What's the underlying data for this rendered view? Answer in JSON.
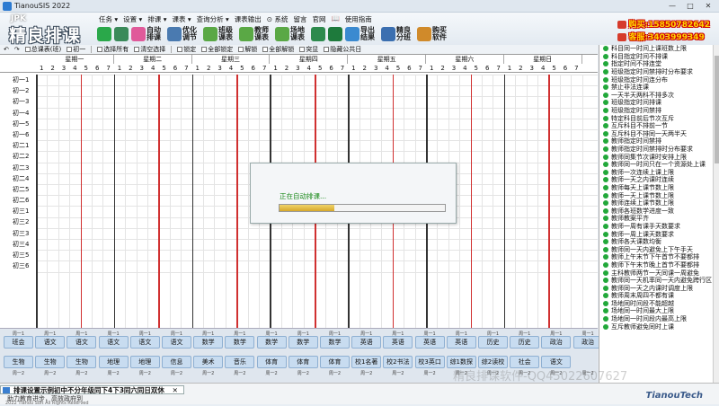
{
  "window": {
    "title": "TianouSIS 2022",
    "controls": [
      "—",
      "□",
      "✕"
    ]
  },
  "brand": {
    "small": "JPK",
    "big": "精良排课"
  },
  "menu": [
    "任务 ▾",
    "设置 ▾",
    "排课 ▾",
    "课表 ▾",
    "查询分析 ▾",
    "课表输出",
    "⊙ 系统",
    "留言",
    "官网",
    "📖",
    "使用指南"
  ],
  "toolbar": [
    {
      "icon": "plus-icon",
      "label": "",
      "color": "#2aa84a"
    },
    {
      "icon": "tools-icon",
      "label": "",
      "color": "#3a8a5a"
    },
    {
      "icon": "auto-schedule-icon",
      "label": "自动排课",
      "color": "#e05a9a"
    },
    {
      "icon": "optimize-icon",
      "label": "优化调节",
      "color": "#4a7ab0"
    },
    {
      "icon": "class-table-icon",
      "label": "班级课表",
      "color": "#5aa845"
    },
    {
      "icon": "teacher-table-icon",
      "label": "教师课表",
      "color": "#5aa845"
    },
    {
      "icon": "venue-table-icon",
      "label": "场地课表",
      "color": "#5aa845"
    },
    {
      "icon": "save-icon",
      "label": "",
      "color": "#2d8a4d"
    },
    {
      "icon": "excel-icon",
      "label": "",
      "color": "#1e7a3c"
    },
    {
      "icon": "export-icon",
      "label": "导出结果",
      "color": "#3b8ad0"
    },
    {
      "icon": "fine-class-icon",
      "label": "精良分班",
      "color": "#3b6fb0"
    },
    {
      "icon": "buy-icon",
      "label": "购买软件",
      "color": "#d08a2a"
    }
  ],
  "contact": {
    "buy": "购买:15850782642",
    "service": "客服:3403999349"
  },
  "subbar": {
    "items": [
      "总课表(班)",
      "初一",
      "选择所有",
      "清空选择",
      "锁定",
      "全部锁定",
      "解锁",
      "全部解锁",
      "突显",
      "隐藏公共日"
    ]
  },
  "grid": {
    "days": [
      "星期一",
      "星期二",
      "星期三",
      "星期四",
      "星期五",
      "星期六",
      "星期日"
    ],
    "periods": [
      "1",
      "2",
      "3",
      "4",
      "5",
      "6",
      "7"
    ],
    "rows": [
      "初一1",
      "初一2",
      "初一3",
      "初一4",
      "初一5",
      "初一6",
      "初二1",
      "初二2",
      "初二3",
      "初二4",
      "初二5",
      "初二6",
      "初三1",
      "初三2",
      "初三3",
      "初三4",
      "初三5",
      "初三6"
    ]
  },
  "dialog": {
    "text": "正在自动排课...",
    "progress": 0.33
  },
  "cards": {
    "top_labels": [
      "周一1",
      "周一1",
      "周一1",
      "周一1",
      "周一1",
      "周一1",
      "周一1",
      "周一1",
      "周一1",
      "周一1",
      "周一1",
      "周一1",
      "周一1",
      "周一1",
      "周一1",
      "周一1",
      "周一1",
      "周一1",
      "周一1"
    ],
    "row1": [
      "班会",
      "语文",
      "语文",
      "语文",
      "语文",
      "语文",
      "数学",
      "数学",
      "数学",
      "数学",
      "数学",
      "英语",
      "英语",
      "英语",
      "英语",
      "历史",
      "历史",
      "政治",
      "政治"
    ],
    "row2": [
      "生物",
      "生物",
      "生物",
      "地理",
      "地理",
      "信息",
      "美术",
      "音乐",
      "体育",
      "体育",
      "体育",
      "校1名著",
      "校2书法",
      "校3英口",
      "综1数探",
      "综2读校",
      "社会",
      "语文"
    ],
    "row3": [
      "周一2",
      "周一2",
      "周一2",
      "周一2",
      "周一2",
      "周一2",
      "周一2",
      "周一2",
      "周一2",
      "周一2",
      "周一2",
      "周一2",
      "周一2",
      "周一2",
      "周一2",
      "周一2",
      "周一2",
      "周一2",
      "周一2"
    ]
  },
  "rules": [
    "科目同一时间上课班数上限",
    "科目指定时间不排课",
    "指定时间不排连堂",
    "班级指定时间禁排时分布要求",
    "班级指定时间连分布",
    "禁止非法连课",
    "一天半天两科不排多次",
    "班级指定时间排课",
    "班级指定时间禁排",
    "特定科目前后节次互斥",
    "互斥科目不排前一节",
    "互斥科目不排同一天两半天",
    "教师指定时间禁排",
    "教师指定时间禁排时分布要求",
    "教师同集节次课时安排上限",
    "教师同一时间只在一个资源处上课",
    "教师一次连续上课上限",
    "教师一天之内课时连续",
    "教师每天上课节数上限",
    "教师一天上课节数上限",
    "教师连续上课节数上限",
    "教师各班数学进度一致",
    "教师教案平齐",
    "教师一周有课手天数要求",
    "教师一周上课天数要求",
    "教师各天课数均衡",
    "教师同一天内避免上下午手天",
    "教师上午末节下午首节不要都排",
    "教师下午末节晚上首节不要都排",
    "主科教师两节一天同课一周避免",
    "教师同一天机率同一天内避免跨行区",
    "教师同一天之内课时调度上限",
    "教师周末周四不都有课",
    "场地同时间段不能超越",
    "场地同一时间最大上限",
    "场地同一时间段内最高上限",
    "互斥教师避免同时上课"
  ],
  "status": {
    "notice": "排课设置示例初中不分年级同下4下3同六同日双休",
    "notice_close": "✕",
    "line2": "助力教育进步，高效政府到",
    "line3": "2022 Tianou Soft All Rights Reserved",
    "company": "TianouTech",
    "watermark": "精良排课软件-QQ45022607627"
  },
  "colors": {
    "accent": "#2d7bd1",
    "grid_red": "#d03030",
    "grid_dark": "#333333",
    "card_bg": "#c8dcf0",
    "check_green": "#22a83a"
  }
}
